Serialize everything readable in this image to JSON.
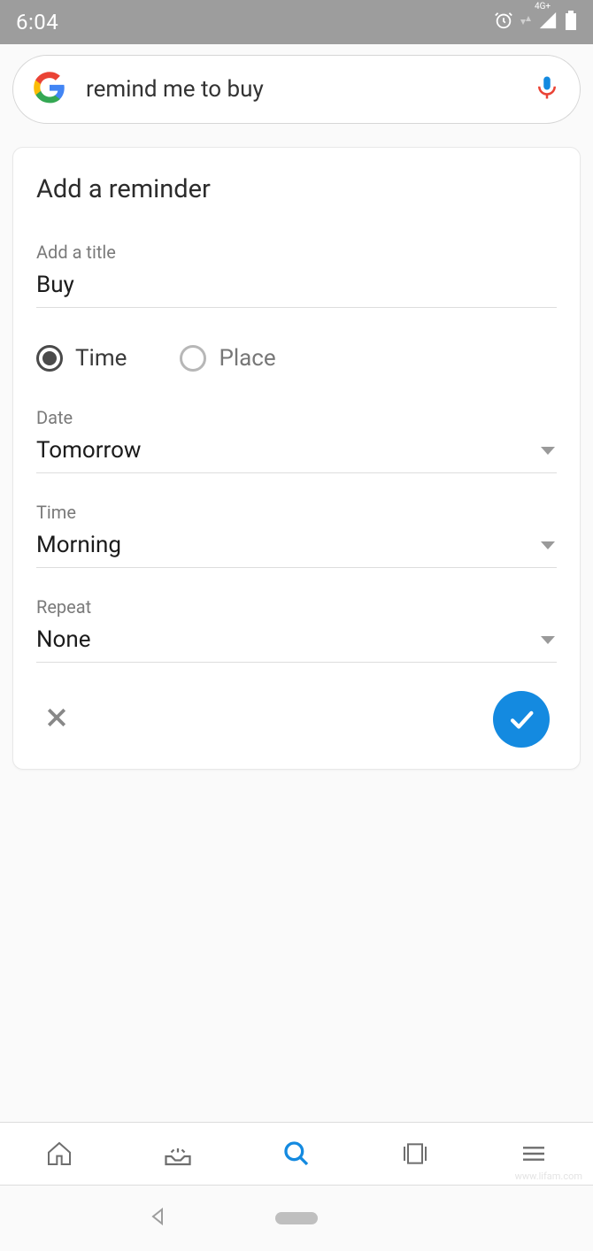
{
  "status": {
    "time": "6:04",
    "network_label": "4G+"
  },
  "search": {
    "query": "remind me to buy"
  },
  "card": {
    "title": "Add a reminder",
    "title_field_label": "Add a title",
    "title_field_value": "Buy",
    "radio_time": "Time",
    "radio_place": "Place",
    "date_label": "Date",
    "date_value": "Tomorrow",
    "time_label": "Time",
    "time_value": "Morning",
    "repeat_label": "Repeat",
    "repeat_value": "None"
  },
  "watermark": "www.lifam.com"
}
